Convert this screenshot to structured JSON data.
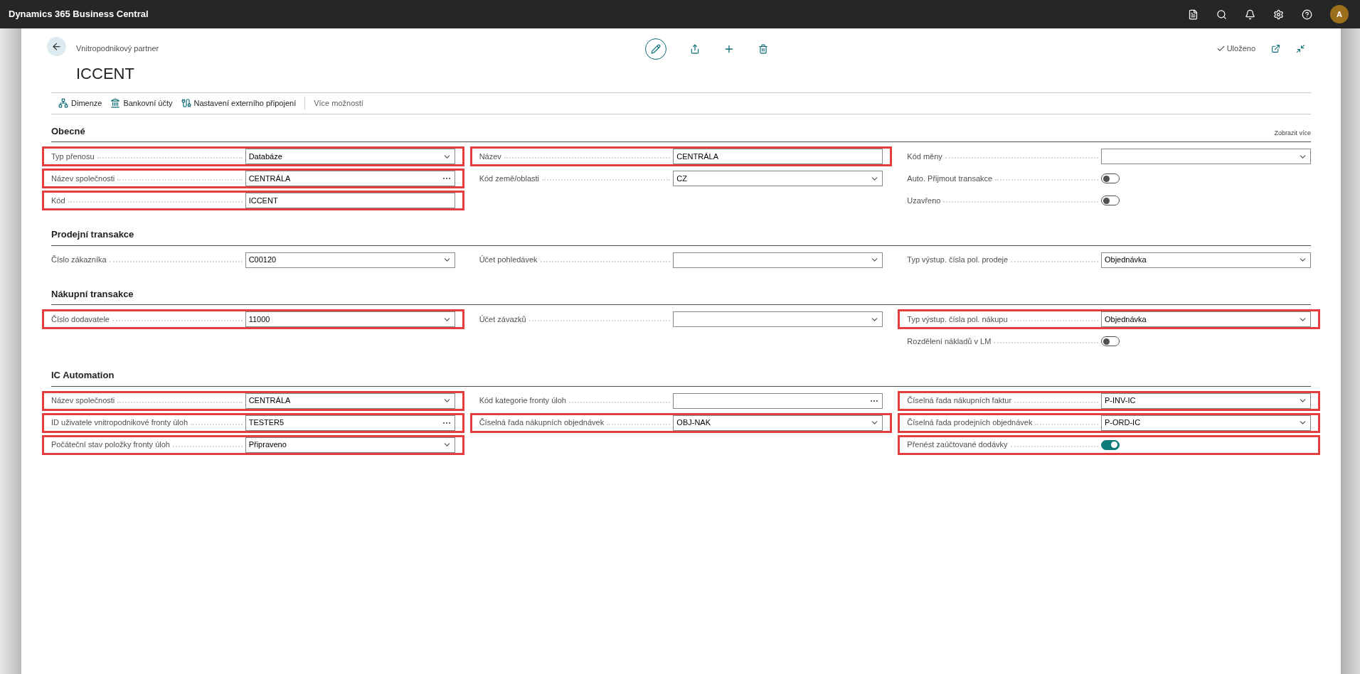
{
  "app": {
    "title": "Dynamics 365 Business Central",
    "avatar": "A"
  },
  "page": {
    "breadcrumb": "Vnitropodnikový partner",
    "title": "ICCENT",
    "status": "Uloženo"
  },
  "actions": [
    {
      "label": "Dimenze",
      "kind": "dimensions"
    },
    {
      "label": "Bankovní účty",
      "kind": "bank"
    },
    {
      "label": "Nastavení externího připojení",
      "kind": "connection"
    },
    {
      "label": "Více možností",
      "kind": "more"
    }
  ],
  "sections": [
    {
      "title": "Obecné",
      "show_more": "Zobrazit více",
      "columns": [
        [
          {
            "label": "Typ přenosu",
            "kind": "dropdown",
            "value": "Databáze",
            "highlighted": true
          },
          {
            "label": "Název společnosti",
            "kind": "lookup",
            "value": "CENTRÁLA",
            "highlighted": true
          },
          {
            "label": "Kód",
            "kind": "text",
            "value": "ICCENT",
            "highlighted": true
          }
        ],
        [
          {
            "label": "Název",
            "kind": "text",
            "value": "CENTRÁLA",
            "highlighted": true
          },
          {
            "label": "Kód země/oblasti",
            "kind": "dropdown",
            "value": "CZ",
            "highlighted": false
          }
        ],
        [
          {
            "label": "Kód měny",
            "kind": "dropdown",
            "highlighted": false
          },
          {
            "label": "Auto. Přijmout transakce",
            "kind": "toggle",
            "on": false,
            "highlighted": false
          },
          {
            "label": "Uzavřeno",
            "kind": "toggle",
            "on": false,
            "highlighted": false
          }
        ]
      ]
    },
    {
      "title": "Prodejní transakce",
      "columns": [
        [
          {
            "label": "Číslo zákazníka",
            "kind": "dropdown",
            "value": "C00120",
            "highlighted": false
          }
        ],
        [
          {
            "label": "Účet pohledávek",
            "kind": "dropdown",
            "highlighted": false
          }
        ],
        [
          {
            "label": "Typ výstup. čísla pol. prodeje",
            "kind": "dropdown",
            "value": "Objednávka",
            "highlighted": false
          }
        ]
      ]
    },
    {
      "title": "Nákupní transakce",
      "columns": [
        [
          {
            "label": "Číslo dodavatele",
            "kind": "dropdown",
            "value": "11000",
            "highlighted": true
          }
        ],
        [
          {
            "label": "Účet závazků",
            "kind": "dropdown",
            "highlighted": false
          }
        ],
        [
          {
            "label": "Typ výstup. čísla pol. nákupu",
            "kind": "dropdown",
            "value": "Objednávka",
            "highlighted": true
          },
          {
            "label": "Rozdělení nákladů v LM",
            "kind": "toggle",
            "on": false,
            "highlighted": false
          }
        ]
      ]
    },
    {
      "title": "IC Automation",
      "columns": [
        [
          {
            "label": "Název společnosti",
            "kind": "dropdown",
            "value": "CENTRÁLA",
            "highlighted": true
          },
          {
            "label": "ID uživatele vnitropodnikové fronty úloh",
            "kind": "lookup",
            "value": "TESTER5",
            "highlighted": true
          },
          {
            "label": "Počáteční stav položky fronty úloh",
            "kind": "dropdown",
            "value": "Připraveno",
            "highlighted": true
          }
        ],
        [
          {
            "label": "Kód kategorie fronty úloh",
            "kind": "lookup",
            "highlighted": false
          },
          {
            "label": "Číselná řada nákupních objednávek",
            "kind": "dropdown",
            "value": "OBJ-NAK",
            "highlighted": true
          }
        ],
        [
          {
            "label": "Číselná řada nákupních faktur",
            "kind": "dropdown",
            "value": "P-INV-IC",
            "highlighted": true
          },
          {
            "label": "Číselná řada prodejních objednávek",
            "kind": "dropdown",
            "value": "P-ORD-IC",
            "highlighted": true
          },
          {
            "label": "Přenést zaúčtované dodávky",
            "kind": "toggle",
            "on": true,
            "highlighted": true
          }
        ]
      ]
    }
  ]
}
